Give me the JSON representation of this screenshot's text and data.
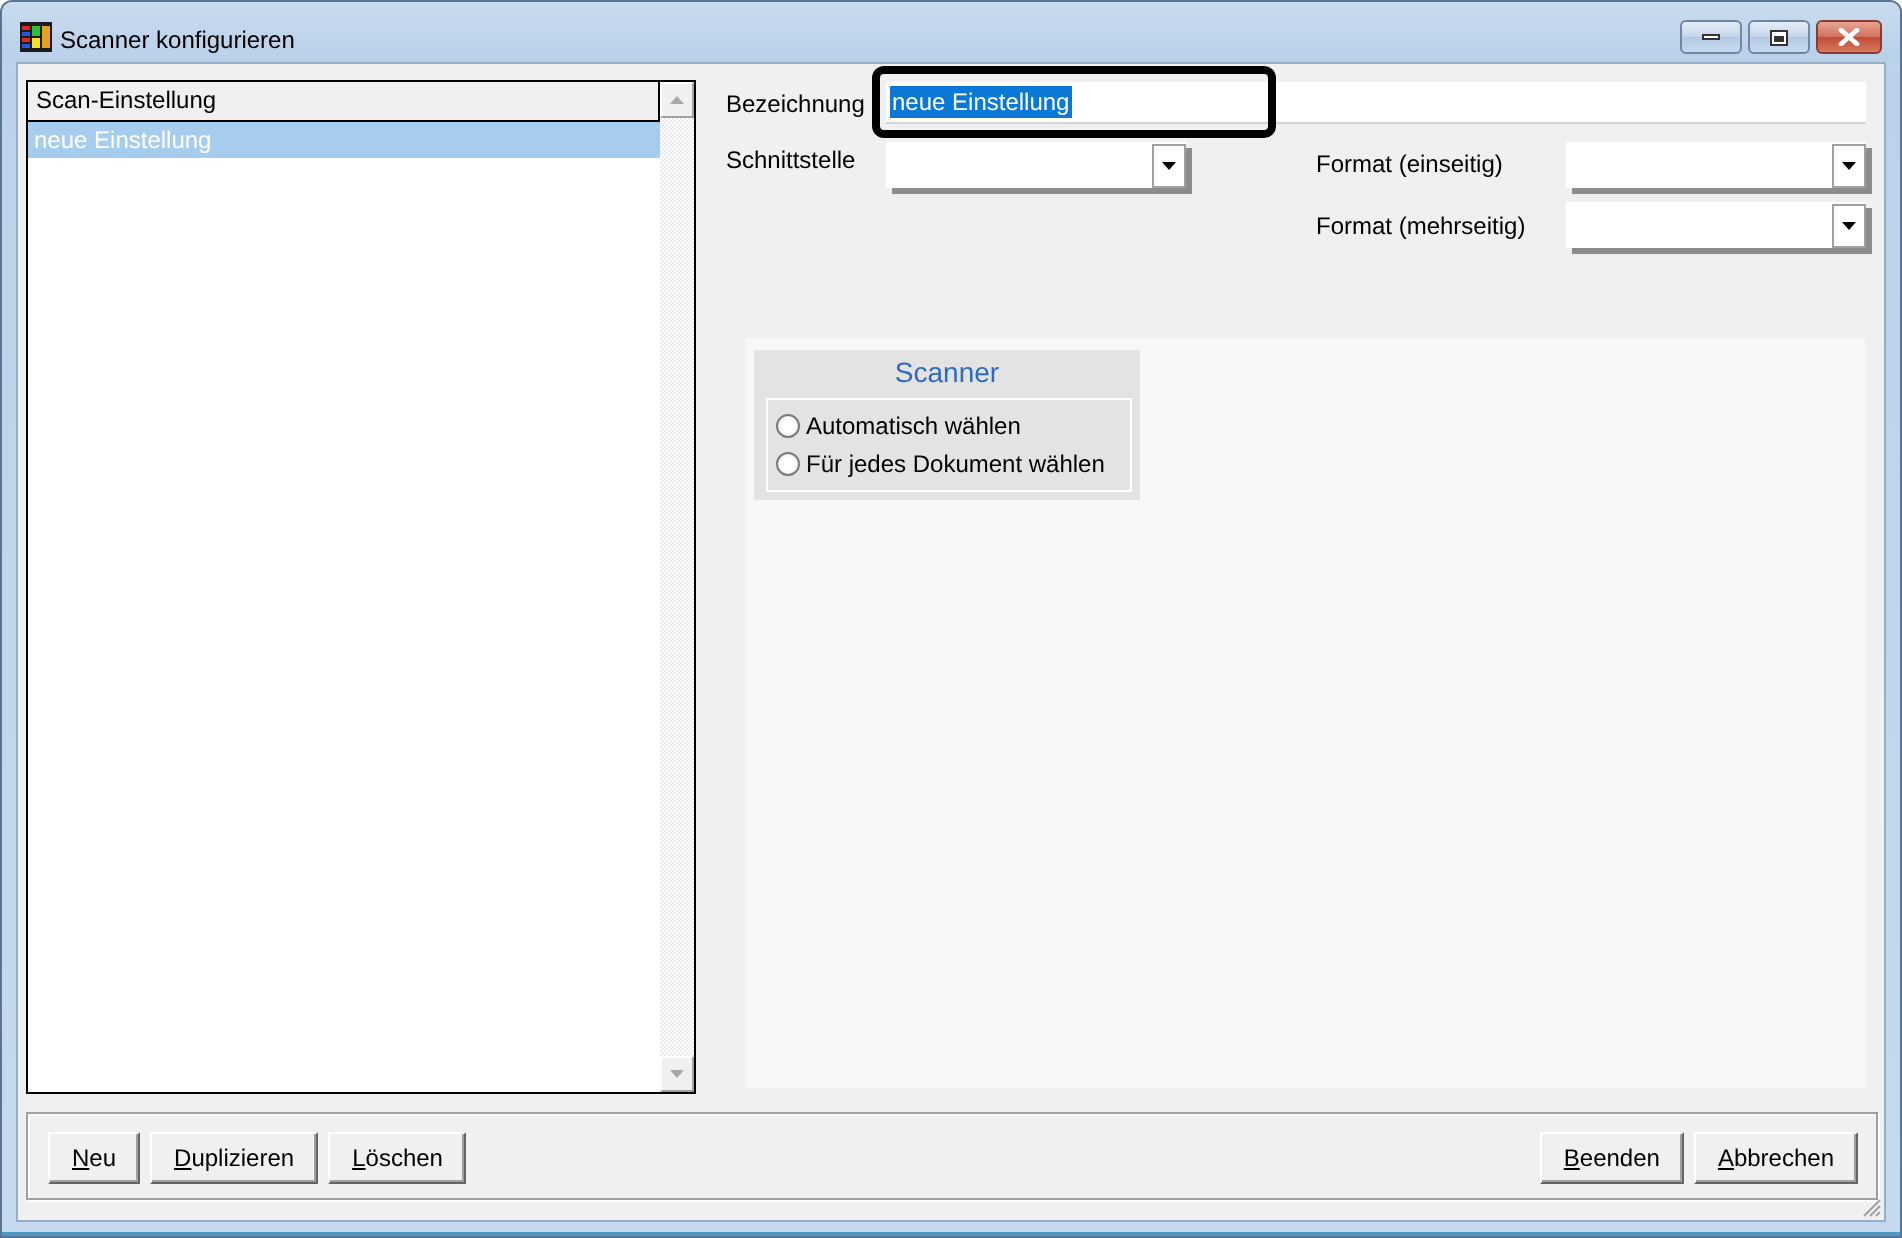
{
  "window": {
    "title": "Scanner konfigurieren"
  },
  "settings_list": {
    "header": "Scan-Einstellung",
    "items": [
      {
        "label": "neue Einstellung",
        "selected": true
      }
    ]
  },
  "name_field": {
    "label": "Bezeichnung",
    "value": "neue Einstellung",
    "text_selected": true,
    "highlighted": true
  },
  "interface_field": {
    "label": "Schnittstelle"
  },
  "format_single_field": {
    "label": "Format (einseitig)"
  },
  "format_multi_field": {
    "label": "Format (mehrseitig)"
  },
  "scanner_group": {
    "title": "Scanner",
    "options": [
      {
        "label": "Automatisch wählen",
        "selected": false
      },
      {
        "label": "Für jedes Dokument wählen",
        "selected": false
      }
    ]
  },
  "buttons_left": [
    "Neu",
    "Duplizieren",
    "Löschen"
  ],
  "buttons_right": [
    "Beenden",
    "Abbrechen"
  ]
}
